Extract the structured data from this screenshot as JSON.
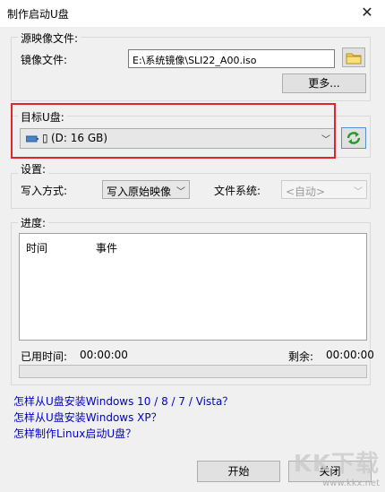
{
  "window": {
    "title": "制作启动U盘",
    "close_glyph": "✕"
  },
  "source": {
    "group_label": "源映像文件:",
    "image_label": "镜像文件:",
    "image_path": "E:\\系统镜像\\SLI22_A00.iso",
    "more_button": "更多..."
  },
  "target": {
    "group_label": "目标U盘:",
    "drive_glyph": "▯",
    "drive_value": "(D: 16 GB)",
    "highlight_color": "#e0252b"
  },
  "settings": {
    "group_label": "设置:",
    "write_mode_label": "写入方式:",
    "write_mode_value": "写入原始映像",
    "fs_label": "文件系统:",
    "fs_value": "<自动>"
  },
  "progress": {
    "group_label": "进度:",
    "columns": [
      "时间",
      "事件"
    ],
    "elapsed_label": "已用时间:",
    "elapsed_value": "00:00:00",
    "remaining_label": "剩余:",
    "remaining_value": "00:00:00",
    "percent": 0
  },
  "links": [
    "怎样从U盘安装Windows 10 / 8 / 7 / Vista？",
    "怎样从U盘安装Windows XP？",
    "怎样制作Linux启动U盘？"
  ],
  "buttons": {
    "start": "开始",
    "close": "关闭"
  },
  "watermark": {
    "big": "KK下载",
    "small": "www.kkx.net"
  }
}
